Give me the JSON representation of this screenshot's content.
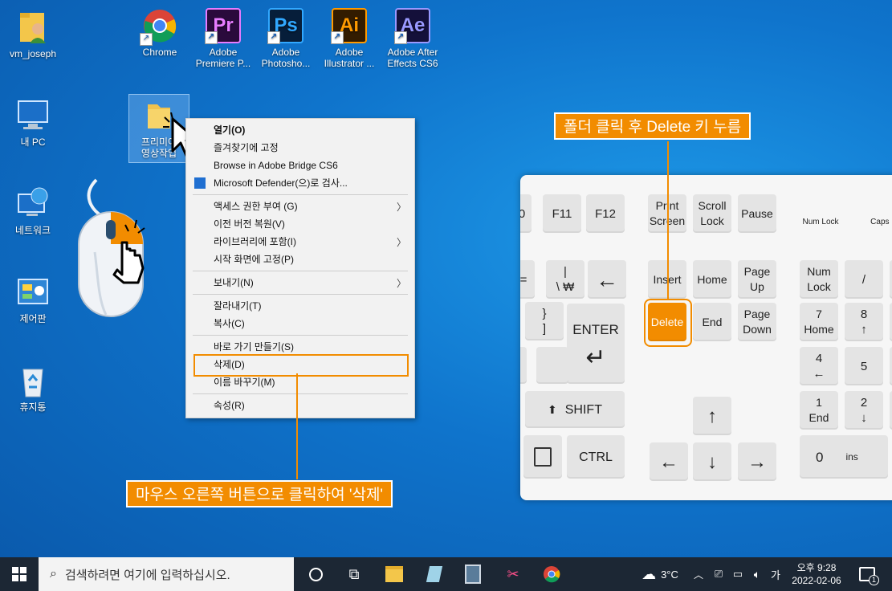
{
  "desktop": {
    "icons": [
      {
        "label": "vm_joseph",
        "name": "user-folder-icon"
      },
      {
        "label": "내 PC",
        "name": "this-pc-icon"
      },
      {
        "label": "네트워크",
        "name": "network-icon"
      },
      {
        "label": "제어판",
        "name": "control-panel-icon"
      },
      {
        "label": "휴지통",
        "name": "recycle-bin-icon"
      },
      {
        "label": "Chrome",
        "name": "chrome-icon"
      },
      {
        "label": "Adobe Premiere P...",
        "name": "premiere-icon",
        "glyph": "Pr"
      },
      {
        "label": "Adobe Photosho...",
        "name": "photoshop-icon",
        "glyph": "Ps"
      },
      {
        "label": "Adobe Illustrator ...",
        "name": "illustrator-icon",
        "glyph": "Ai"
      },
      {
        "label": "Adobe After Effects CS6",
        "name": "after-effects-icon",
        "glyph": "Ae"
      }
    ],
    "selected_folder": {
      "label": "프리미어 영상작업",
      "name": "folder-icon"
    }
  },
  "context_menu": {
    "items": [
      "열기(O)",
      "즐겨찾기에 고정",
      "Browse in Adobe Bridge CS6",
      "Microsoft Defender(으)로 검사...",
      "액세스 권한 부여 (G)",
      "이전 버전 복원(V)",
      "라이브러리에 포함(I)",
      "시작 화면에 고정(P)",
      "보내기(N)",
      "잘라내기(T)",
      "복사(C)",
      "바로 가기 만들기(S)",
      "삭제(D)",
      "이름 바꾸기(M)",
      "속성(R)"
    ]
  },
  "callouts": {
    "keyboard": "폴더 클릭 후 Delete 키 누름",
    "mouse": "마우스 오른쪽 버튼으로 클릭하여 '삭제'"
  },
  "keyboard": {
    "f10_partial": "0",
    "f11": "F11",
    "f12": "F12",
    "print_screen": "Print\nScreen",
    "scroll_lock": "Scroll\nLock",
    "pause": "Pause",
    "num_lock_indicator": "Num Lock",
    "caps_lock_indicator": "Caps L",
    "equals": "=",
    "backslash": "|\n\\ ₩",
    "backspace": "←",
    "insert": "Insert",
    "home": "Home",
    "page_up": "Page\nUp",
    "num_lock": "Num\nLock",
    "slash": "/",
    "bracket": "}\n]",
    "enter": "ENTER",
    "delete": "Delete",
    "end": "End",
    "page_down": "Page\nDown",
    "num7": "7\nHome",
    "num8": "8\n↑",
    "num4": "4\n←",
    "num5": "5",
    "shift": "SHIFT",
    "up": "↑",
    "num1": "1\nEnd",
    "num2": "2\n↓",
    "ctrl": "CTRL",
    "left": "←",
    "down": "↓",
    "right": "→",
    "num0": "0",
    "ins": "ins"
  },
  "taskbar": {
    "search_placeholder": "검색하려면 여기에 입력하십시오.",
    "weather": "3°C",
    "ime": "가",
    "time": "오후 9:28",
    "date": "2022-02-06",
    "notification_count": "1"
  }
}
